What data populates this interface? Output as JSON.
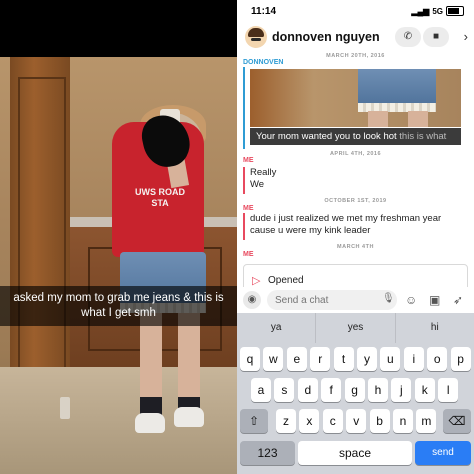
{
  "left_panel": {
    "caption": "asked my mom to grab me jeans & this is what I get smh",
    "shirt_text": "UWS ROAD STA"
  },
  "status_bar": {
    "time": "11:14",
    "signal": "5G"
  },
  "header": {
    "chat_name": "donnoven nguyen",
    "call_icon": "phone-icon",
    "video_icon": "video-icon",
    "close_icon": "close-icon"
  },
  "chat": {
    "date_1": "MARCH 20TH, 2016",
    "sender_1": "DONNOVEN",
    "snap_caption": "Your mom wanted you to look hot",
    "snap_caption_faded": "this is what",
    "date_2": "APRIL 4TH, 2016",
    "sender_2": "ME",
    "msg_2a": "Really",
    "msg_2b": "We",
    "date_3": "OCTOBER 1ST, 2019",
    "sender_3": "ME",
    "msg_3": "dude i just realized we met my freshman year cause u were my kink leader",
    "date_4": "MARCH 4TH",
    "sender_4": "ME",
    "opened_label": "Opened"
  },
  "input_bar": {
    "placeholder": "Send a chat"
  },
  "keyboard": {
    "suggestions": [
      "ya",
      "yes",
      "hi"
    ],
    "row1": [
      "q",
      "w",
      "e",
      "r",
      "t",
      "y",
      "u",
      "i",
      "o",
      "p"
    ],
    "row2": [
      "a",
      "s",
      "d",
      "f",
      "g",
      "h",
      "j",
      "k",
      "l"
    ],
    "row3": [
      "z",
      "x",
      "c",
      "v",
      "b",
      "n",
      "m"
    ],
    "num_key": "123",
    "space_key": "space",
    "send_key": "send",
    "shift_icon": "shift-icon",
    "delete_icon": "backspace-icon"
  },
  "colors": {
    "blue_accent": "#2f9cd4",
    "red_accent": "#e84a5f",
    "send_blue": "#2a7df5"
  }
}
